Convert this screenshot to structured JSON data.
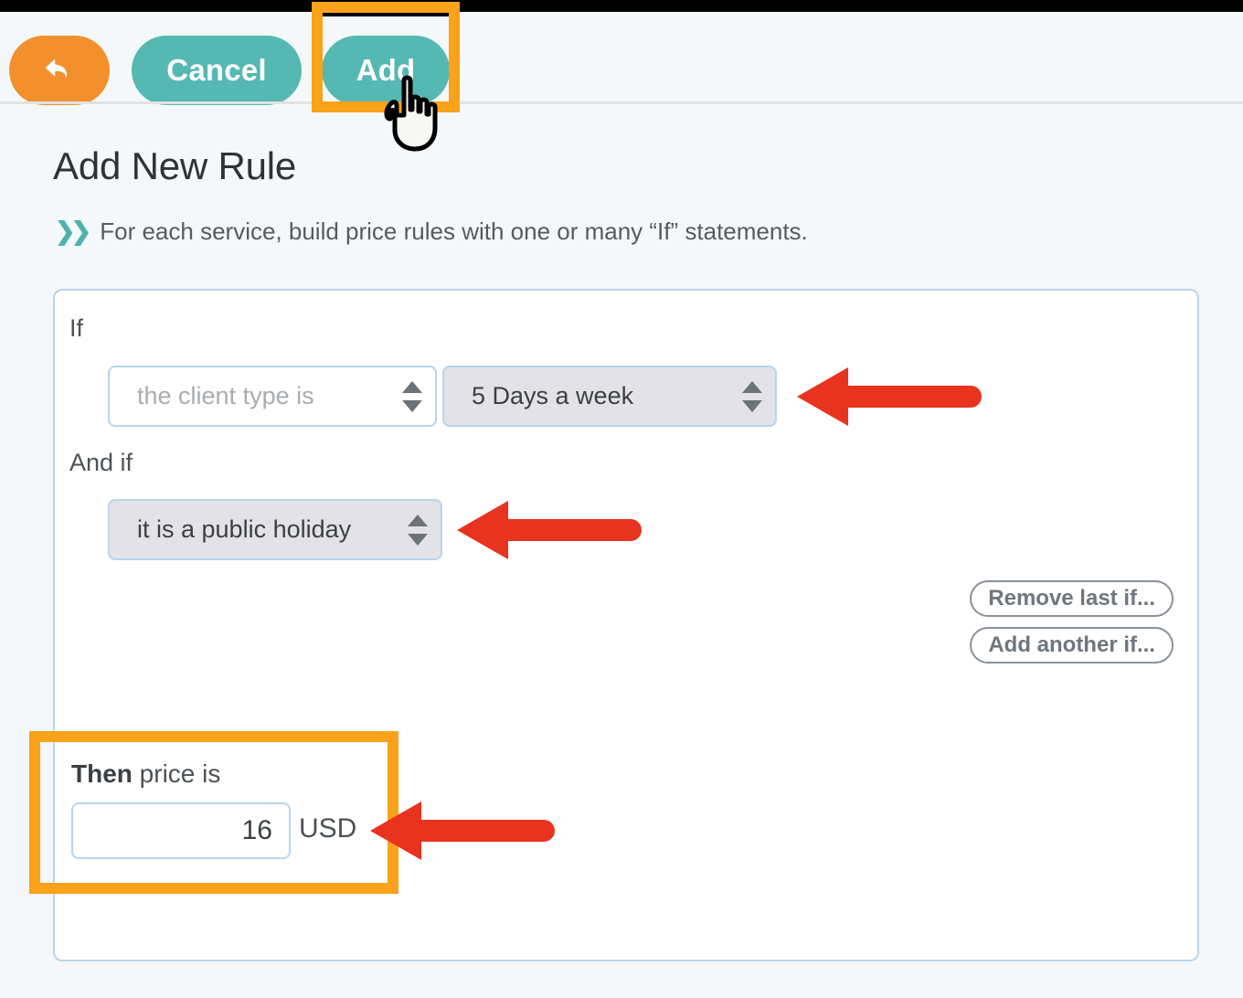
{
  "toolbar": {
    "back_icon": "undo-arrow-icon",
    "cancel_label": "Cancel",
    "add_label": "Add",
    "cursor_icon": "pointing-hand-cursor"
  },
  "header": {
    "title": "Add New Rule",
    "subtitle": "For each service, build price rules with one or many “If” statements.",
    "subtitle_icon": "double-chevron-right-icon"
  },
  "rule": {
    "if_label": "If",
    "and_if_label": "And if",
    "condition_select": {
      "value": "the client type is",
      "placeholder": "the client type is",
      "state": "placeholder"
    },
    "value_select": {
      "value": "5 Days a week",
      "state": "selected"
    },
    "second_condition_select": {
      "value": "it is a public holiday",
      "state": "selected"
    },
    "remove_last_if_label": "Remove last if...",
    "add_another_if_label": "Add another if...",
    "then_label_bold": "Then",
    "then_label_rest": " price is",
    "price_value": "16",
    "currency": "USD"
  },
  "annotations": {
    "highlight_color": "#f9a21a",
    "arrow_color": "#e8331f",
    "highlighted_elements": [
      "add-button",
      "then-price-block"
    ],
    "arrow_targets": [
      "value-select",
      "second-condition-select",
      "price-input"
    ]
  },
  "colors": {
    "accent_teal": "#55b8b3",
    "accent_orange": "#f2902d",
    "page_background": "#f4f8fb",
    "card_border": "#b9d5ea",
    "select_gray": "#e2e2e8"
  }
}
